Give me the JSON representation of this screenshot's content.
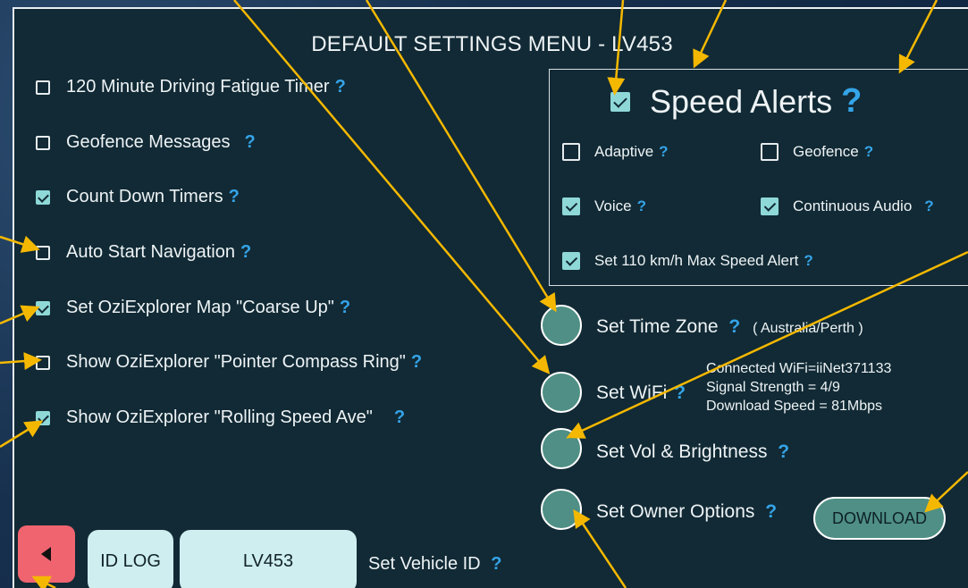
{
  "title": "DEFAULT SETTINGS MENU - LV453",
  "help_glyph": "?",
  "options": [
    {
      "label": "120 Minute Driving Fatigue Timer",
      "checked": false
    },
    {
      "label": "Geofence Messages",
      "checked": false
    },
    {
      "label": "Count Down Timers",
      "checked": true
    },
    {
      "label": "Auto Start Navigation",
      "checked": false
    },
    {
      "label": "Set OziExplorer Map \"Coarse Up\"",
      "checked": true
    },
    {
      "label": "Show OziExplorer \"Pointer Compass Ring\"",
      "checked": false
    },
    {
      "label": "Show OziExplorer \"Rolling Speed Ave\"",
      "checked": true
    }
  ],
  "speed_alerts": {
    "label": "Speed Alerts",
    "checked": true,
    "adaptive": {
      "label": "Adaptive",
      "checked": false
    },
    "geofence": {
      "label": "Geofence",
      "checked": false
    },
    "voice": {
      "label": "Voice",
      "checked": true
    },
    "continuous_audio": {
      "label": "Continuous Audio",
      "checked": true
    },
    "max_speed": {
      "label": "Set 110 km/h Max Speed Alert",
      "checked": true
    }
  },
  "settings": {
    "time_zone": {
      "label": "Set Time Zone",
      "value": "( Australia/Perth )"
    },
    "wifi": {
      "label": "Set WiFi",
      "connected": "Connected WiFi=iiNet371133",
      "signal": "Signal Strength = 4/9",
      "download": "Download Speed = 81Mbps"
    },
    "vol_brightness": {
      "label": "Set Vol & Brightness"
    },
    "owner": {
      "label": "Set Owner Options"
    }
  },
  "download_button": "DOWNLOAD",
  "bottom": {
    "id_log": "ID LOG",
    "vehicle_id": "LV453",
    "set_vehicle_label": "Set Vehicle ID"
  },
  "colors": {
    "panel_bg": "#112a35",
    "checkbox_checked": "#8fd8d8",
    "help_icon": "#35a4e8",
    "circle_button": "#4f8f85",
    "back_button": "#f06470",
    "pill_button": "#cfeef0",
    "annotation_arrow": "#f5b800"
  },
  "icons": [
    "help-icon",
    "back-arrow-icon",
    "checkbox-icon",
    "radio-circle-icon"
  ]
}
